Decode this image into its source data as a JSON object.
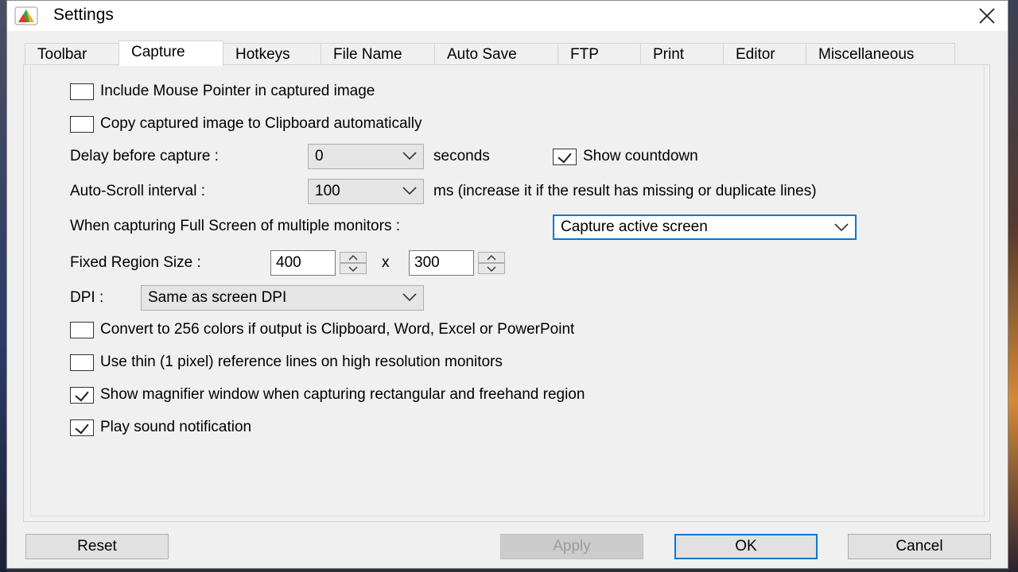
{
  "window": {
    "title": "Settings"
  },
  "tabs": [
    {
      "label": "Toolbar"
    },
    {
      "label": "Capture"
    },
    {
      "label": "Hotkeys"
    },
    {
      "label": "File Name"
    },
    {
      "label": "Auto Save"
    },
    {
      "label": "FTP"
    },
    {
      "label": "Print"
    },
    {
      "label": "Editor"
    },
    {
      "label": "Miscellaneous"
    }
  ],
  "active_tab": "Capture",
  "capture": {
    "include_pointer": {
      "label": "Include Mouse Pointer in captured image",
      "checked": false
    },
    "copy_clipboard": {
      "label": "Copy captured image to Clipboard automatically",
      "checked": false
    },
    "delay": {
      "label": "Delay before capture :",
      "value": "0",
      "unit": "seconds"
    },
    "show_countdown": {
      "label": "Show countdown",
      "checked": true
    },
    "autoscroll": {
      "label": "Auto-Scroll interval :",
      "value": "100",
      "note": "ms (increase it if the result has missing or duplicate lines)"
    },
    "multi_monitor": {
      "label": "When capturing Full Screen of multiple monitors :",
      "value": "Capture active screen"
    },
    "fixed_region": {
      "label": "Fixed Region Size :",
      "width": "400",
      "separator": "x",
      "height": "300"
    },
    "dpi": {
      "label": "DPI :",
      "value": "Same as screen DPI"
    },
    "convert_256": {
      "label": "Convert to 256 colors if output is Clipboard, Word, Excel or PowerPoint",
      "checked": false
    },
    "thin_lines": {
      "label": "Use thin (1 pixel) reference lines on high resolution monitors",
      "checked": false
    },
    "magnifier": {
      "label": "Show magnifier window when capturing rectangular and freehand region",
      "checked": true
    },
    "sound": {
      "label": "Play sound notification",
      "checked": true
    }
  },
  "buttons": {
    "reset": "Reset",
    "apply": "Apply",
    "ok": "OK",
    "cancel": "Cancel"
  },
  "colors": {
    "accent": "#0078d7",
    "window_bg": "#f0f0f0"
  }
}
